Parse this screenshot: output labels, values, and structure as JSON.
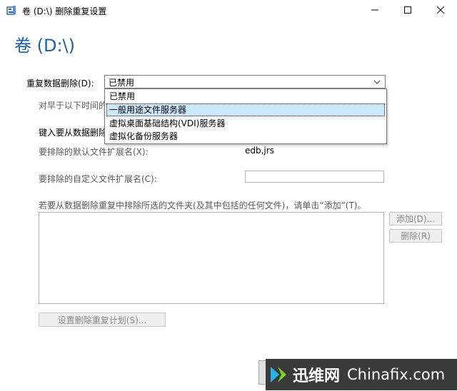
{
  "window": {
    "title": "卷 (D:\\) 删除重复设置",
    "minimize_icon": "minimize-icon",
    "maximize_icon": "maximize-icon",
    "close_icon": "close-icon"
  },
  "page": {
    "heading": "卷 (D:\\)"
  },
  "dedup": {
    "label": "重复数据删除(D):",
    "selected": "已禁用",
    "options": [
      "已禁用",
      "一般用途文件服务器",
      "虚拟桌面基础结构(VDI)服务器",
      "虚拟化备份服务器"
    ],
    "highlighted_index": 1
  },
  "form": {
    "age_label_partial": "对早于以下时间的",
    "exclude_label_partial": "键入要从数据删除",
    "default_ext_label": "要排除的默认文件扩展名(X):",
    "default_ext_value": "edb,jrs",
    "custom_ext_label": "要排除的自定义文件扩展名(C):",
    "custom_ext_value": "",
    "folder_instructions": "若要从数据删除重复中排除所选的文件夹(及其中包括的任何文件)，请单击“添加”(T)。",
    "add_button": "添加(D)...",
    "remove_button": "删除(R)",
    "schedule_button": "设置删除重复计划(S)..."
  },
  "watermark": {
    "cn": "迅维网",
    "en": "Chinafix.com"
  },
  "colors": {
    "heading": "#1d5fa8",
    "highlight": "#cce8ff",
    "watermark_bg": "#3a3a3a"
  }
}
